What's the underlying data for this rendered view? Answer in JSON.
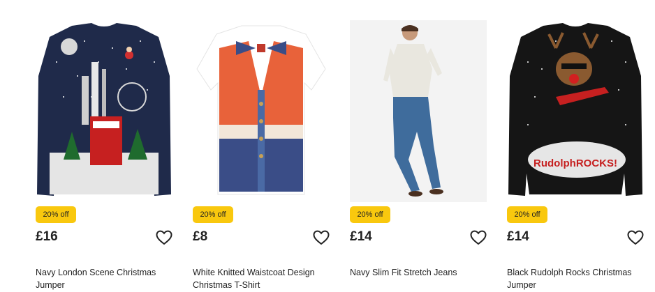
{
  "products": [
    {
      "badge": "20% off",
      "price": "£16",
      "title": "Navy London Scene Christmas Jumper",
      "image_icon": "navy-london-jumper-image",
      "wishlist_icon": "heart-outline-icon"
    },
    {
      "badge": "20% off",
      "price": "£8",
      "title": "White Knitted Waistcoat Design Christmas T-Shirt",
      "image_icon": "waistcoat-tshirt-image",
      "wishlist_icon": "heart-outline-icon"
    },
    {
      "badge": "20% off",
      "price": "£14",
      "title": "Navy Slim Fit Stretch Jeans",
      "image_icon": "man-in-jeans-photo",
      "wishlist_icon": "heart-outline-icon"
    },
    {
      "badge": "20% off",
      "price": "£14",
      "title": "Black Rudolph Rocks Christmas Jumper",
      "image_icon": "rudolph-rocks-jumper-image",
      "image_text": "RudolphROCKS!",
      "wishlist_icon": "heart-outline-icon"
    }
  ],
  "colors": {
    "badge_bg": "#f9c80e",
    "text": "#222222",
    "navy": "#1f2a4a",
    "orange": "#e8623a",
    "black": "#151515"
  }
}
